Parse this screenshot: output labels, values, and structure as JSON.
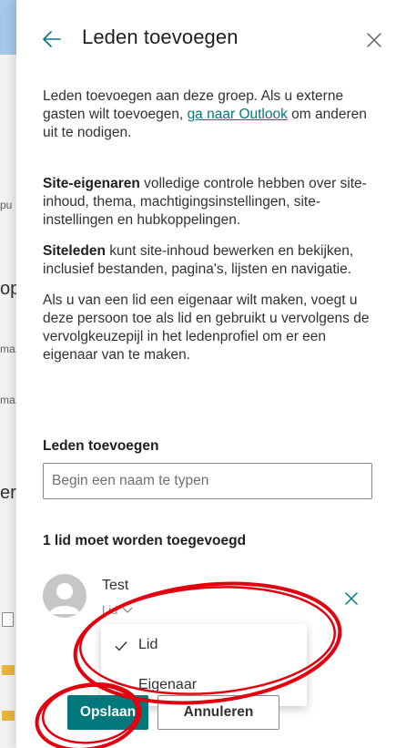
{
  "background": {
    "fragments": [
      "pu",
      "op",
      "ma",
      "ma",
      "er"
    ]
  },
  "panel": {
    "title": "Leden toevoegen",
    "back_icon": "arrow-left-icon",
    "close_icon": "close-icon",
    "intro": {
      "text_before_link": "Leden toevoegen aan deze groep. Als u externe gasten wilt toevoegen, ",
      "link_text": "ga naar Outlook",
      "text_after_link": " om anderen uit te nodigen."
    },
    "owners": {
      "bold": "Site-eigenaren",
      "text": " volledige controle hebben over site-inhoud, thema, machtigingsinstellingen, site-instellingen en hubkoppelingen."
    },
    "members": {
      "bold": "Siteleden",
      "text": " kunt site-inhoud bewerken en bekijken, inclusief bestanden, pagina's, lijsten en navigatie."
    },
    "owner_hint": "Als u van een lid een eigenaar wilt maken, voegt u deze persoon toe als lid en gebruikt u vervolgens de vervolgkeuzepijl in het ledenprofiel om er een eigenaar van te maken.",
    "add_members_label": "Leden toevoegen",
    "search_placeholder": "Begin een naam te typen",
    "count_label": "1 lid moet worden toegevoegd",
    "member": {
      "name": "Test",
      "role": "Lid"
    },
    "role_menu": {
      "options": [
        "Lid",
        "Eigenaar"
      ],
      "selected": "Lid"
    },
    "save_label": "Opslaan",
    "cancel_label": "Annuleren"
  },
  "colors": {
    "accent": "#03787c",
    "annotation": "#e3000f"
  }
}
